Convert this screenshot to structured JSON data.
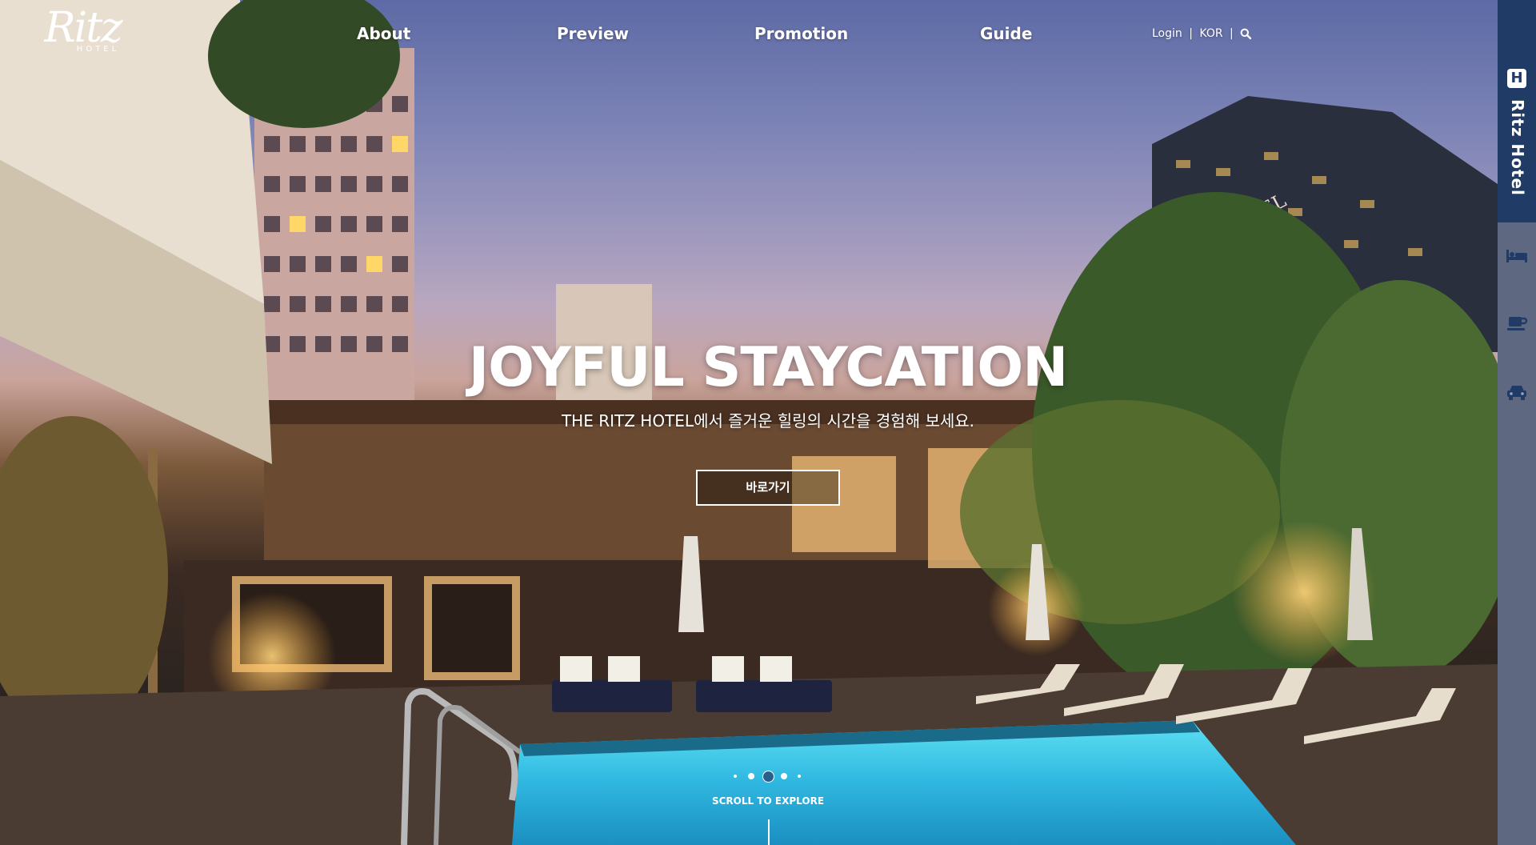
{
  "brand": {
    "logo_script": "Ritz",
    "logo_sub": "HOTEL"
  },
  "nav": {
    "items": [
      "About",
      "Preview",
      "Promotion",
      "Guide"
    ]
  },
  "utility": {
    "login": "Login",
    "separator": "|",
    "language": "KOR"
  },
  "hero": {
    "headline": "JOYFUL STAYCATION",
    "subline": "THE RITZ HOTEL에서 즐거운 힐링의 시간을 경험해 보세요.",
    "cta_label": "바로가기",
    "building_sign": "RITZ HOTEL",
    "scroll_label": "SCROLL TO EXPLORE",
    "slides": {
      "count": 5,
      "active_index": 2
    }
  },
  "side_panel": {
    "badge_letter": "H",
    "title": "Ritz Hotel",
    "icons": [
      "bed-icon",
      "coffee-cup-icon",
      "car-icon"
    ],
    "colors": {
      "top": "#1f3b66",
      "panel": "#96a5c8"
    }
  },
  "colors": {
    "text": "#ffffff",
    "pool": "#39c3e6"
  }
}
